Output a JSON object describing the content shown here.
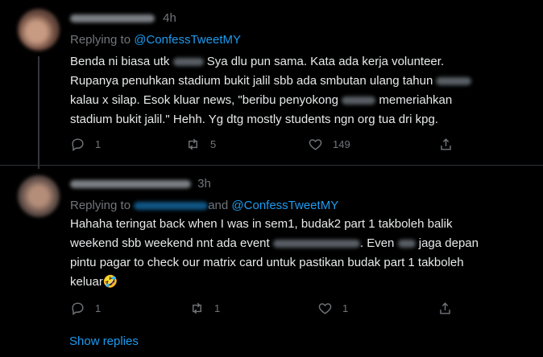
{
  "tweets": [
    {
      "time": "4h",
      "replying_prefix": "Replying to ",
      "mentions": [
        "@ConfessTweetMY"
      ],
      "body_segments": [
        "Benda ni biasa utk ",
        " Sya dlu pun sama. Kata ada kerja volunteer.",
        "Rupanya penuhkan stadium bukit jalil sbb ada smbutan ulang tahun ",
        "kalau x silap. Esok kluar news, \"beribu penyokong ",
        " memeriahkan",
        "stadium bukit jalil.\" Hehh. Yg dtg mostly students ngn org tua dri kpg."
      ],
      "stats": {
        "replies": "1",
        "retweets": "5",
        "likes": "149"
      }
    },
    {
      "time": "3h",
      "replying_prefix": "Replying to ",
      "replying_and": "and ",
      "mentions": [
        "@ConfessTweetMY"
      ],
      "body_segments": [
        "Hahaha teringat back when I was in sem1, budak2 part 1 takboleh balik",
        "weekend sbb weekend nnt ada event ",
        ". Even ",
        " jaga depan",
        "pintu pagar to check our matrix card untuk pastikan budak part 1 takboleh",
        "keluar🤣"
      ],
      "stats": {
        "replies": "1",
        "retweets": "1",
        "likes": "1"
      }
    }
  ],
  "show_replies": "Show replies",
  "icons": [
    "reply-icon",
    "retweet-icon",
    "like-icon",
    "share-icon"
  ],
  "colors": {
    "background": "#000000",
    "text": "#e7e9ea",
    "muted": "#71767b",
    "link": "#1d9bf0"
  }
}
